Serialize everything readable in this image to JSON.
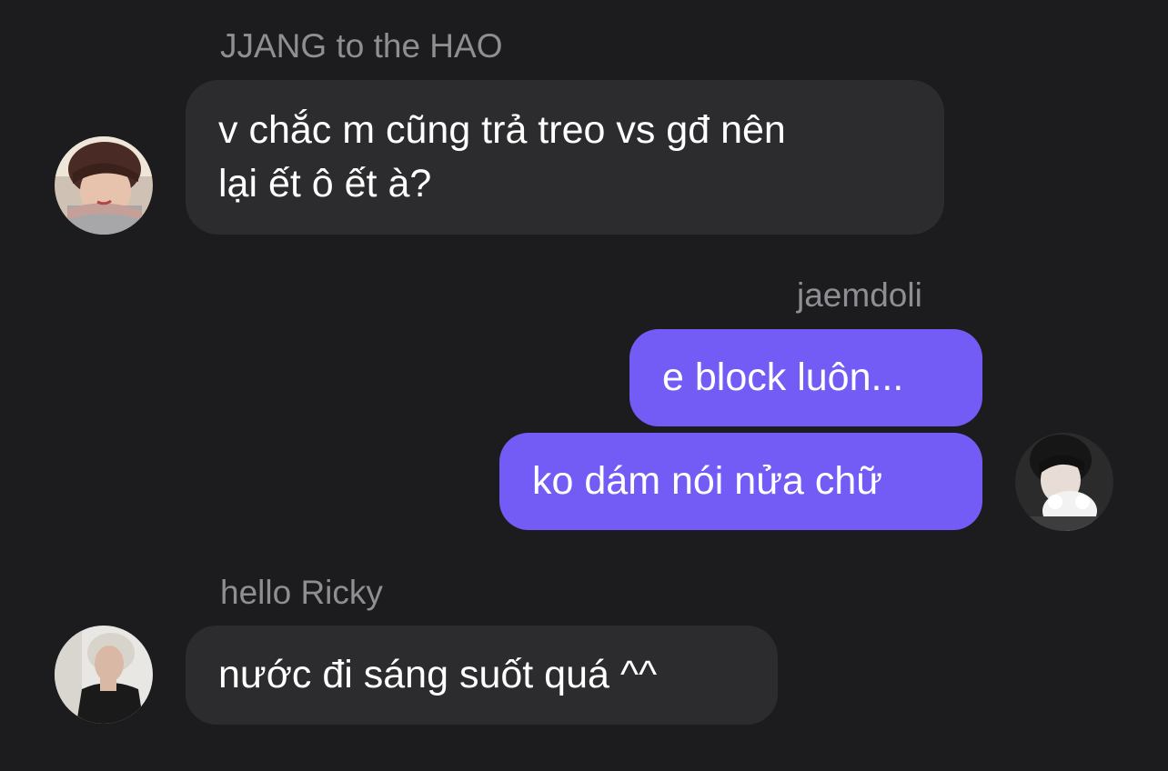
{
  "messages": [
    {
      "sender": "JJANG to the HAO",
      "direction": "incoming",
      "lines": [
        "v chắc m cũng trả treo vs gđ nên",
        "lại ết ô ết à?"
      ]
    },
    {
      "sender": "jaemdoli",
      "direction": "outgoing",
      "lines": [
        "e block luôn..."
      ]
    },
    {
      "sender": "jaemdoli",
      "direction": "outgoing",
      "lines": [
        "ko dám nói nửa chữ"
      ]
    },
    {
      "sender": "hello Ricky",
      "direction": "incoming",
      "lines": [
        "nước đi sáng suốt quá ^^"
      ]
    }
  ],
  "colors": {
    "background": "#1c1c1e",
    "incoming_bubble": "#2c2c2e",
    "outgoing_bubble": "#735cf5",
    "sender_label": "#8e8e93",
    "message_text": "#ffffff"
  },
  "icons": {
    "avatar_1": "user-avatar-photo",
    "avatar_2": "user-avatar-photo",
    "avatar_3": "user-avatar-photo"
  }
}
